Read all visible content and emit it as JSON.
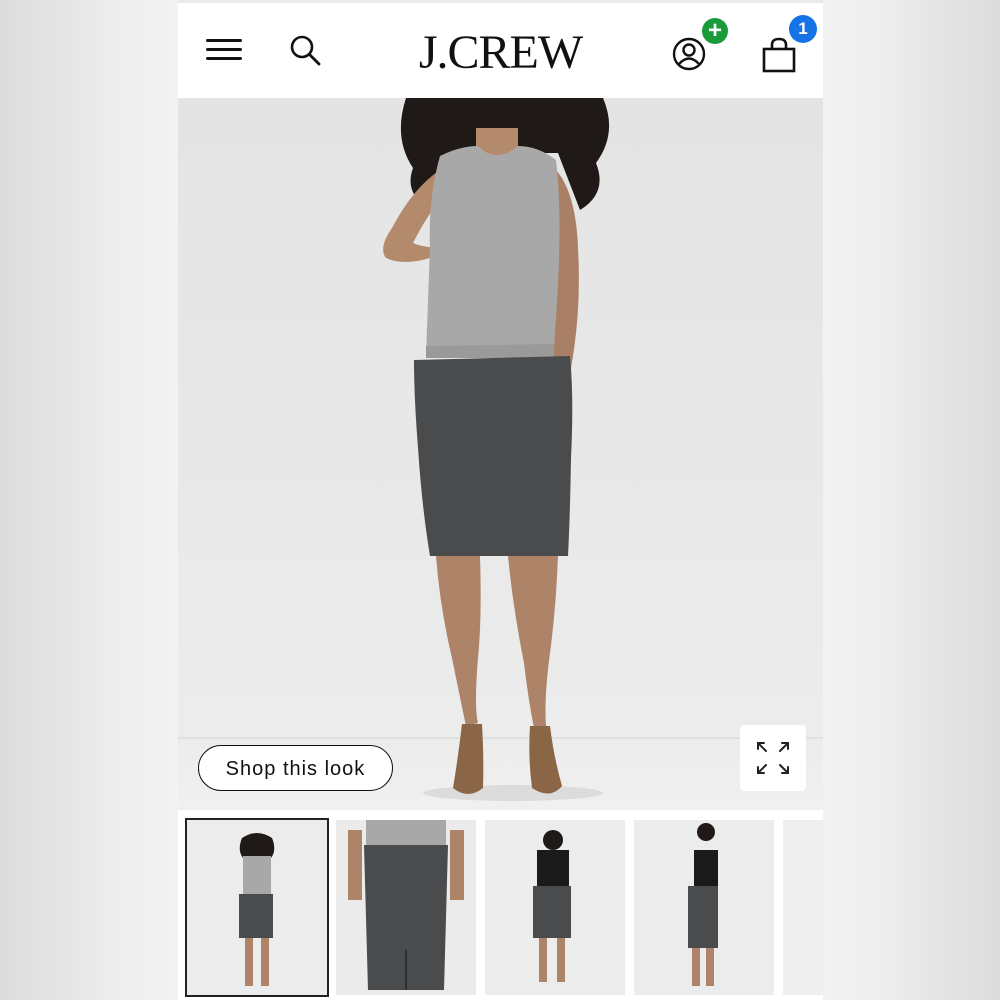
{
  "header": {
    "menu_icon": "hamburger-menu-icon",
    "search_icon": "search-icon",
    "logo_text": "J.CREW",
    "account_icon": "account-icon",
    "account_badge": "+",
    "bag_icon": "shopping-bag-icon",
    "bag_count": "1"
  },
  "hero": {
    "image": "model wearing gray sleeveless sweater and charcoal pencil skirt",
    "shop_look_label": "Shop this look",
    "expand_icon": "expand-icon"
  },
  "thumbnails": [
    {
      "alt": "full outfit front view",
      "selected": true
    },
    {
      "alt": "skirt back detail"
    },
    {
      "alt": "black top with skirt back view"
    },
    {
      "alt": "black sleeveless top with skirt side view"
    }
  ],
  "colors": {
    "plus_badge": "#1a9b3a",
    "count_badge": "#1673e6"
  }
}
